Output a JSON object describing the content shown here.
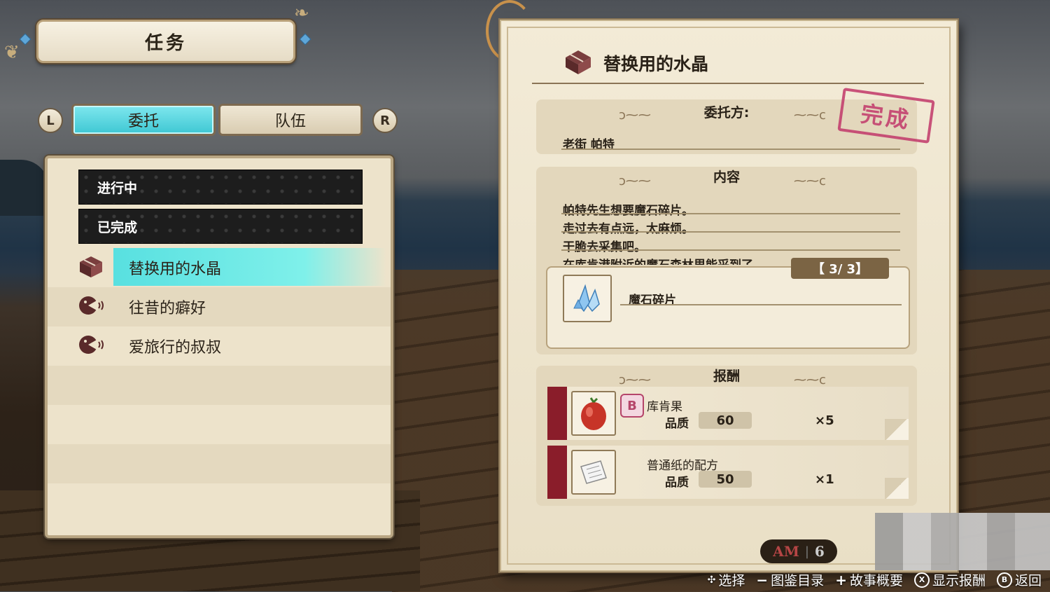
{
  "screen": {
    "title": "任务"
  },
  "tabs": {
    "left_shoulder": "L",
    "right_shoulder": "R",
    "items": [
      {
        "label": "委托",
        "active": true
      },
      {
        "label": "队伍",
        "active": false
      }
    ]
  },
  "quest_list": {
    "categories": [
      {
        "label": "进行中"
      },
      {
        "label": "已完成"
      }
    ],
    "quests": [
      {
        "label": "替换用的水晶",
        "icon": "box-icon",
        "selected": true
      },
      {
        "label": "往昔的癖好",
        "icon": "speech-icon",
        "selected": false
      },
      {
        "label": "爱旅行的叔叔",
        "icon": "speech-icon",
        "selected": false
      }
    ]
  },
  "detail": {
    "title": "替换用的水晶",
    "stamp": "完成",
    "client": {
      "heading": "委托方:",
      "name": "老街 帕特"
    },
    "content": {
      "heading": "内容",
      "lines": [
        "帕特先生想要魔石碎片。",
        "走过去有点远，太麻烦。",
        "干脆去采集吧。",
        "在库肯港附近的魔石森林里能采到了。"
      ]
    },
    "required_item": {
      "name": "魔石碎片",
      "progress": "【 3/ 3】",
      "icon": "crystal-icon"
    },
    "rewards": {
      "heading": "报酬",
      "items": [
        {
          "name": "库肯果",
          "badge": "B",
          "quality_label": "品质",
          "quality": "60",
          "qty": "×5",
          "icon": "red-fruit-icon"
        },
        {
          "name": "普通纸的配方",
          "badge": "",
          "quality_label": "品质",
          "quality": "50",
          "qty": "×1",
          "icon": "paper-icon"
        }
      ]
    }
  },
  "clock": {
    "period": "AM",
    "hour": "6"
  },
  "hints": [
    {
      "glyph": "dpad-icon",
      "label": "选择"
    },
    {
      "glyph": "minus-icon",
      "label": "图鉴目录"
    },
    {
      "glyph": "plus-icon",
      "label": "故事概要"
    },
    {
      "glyph": "x-button-icon",
      "key": "X",
      "label": "显示报酬"
    },
    {
      "glyph": "b-button-icon",
      "key": "B",
      "label": "返回"
    }
  ],
  "colors": {
    "accent_cyan": "#5fe0e4",
    "stamp_pink": "#c2386a",
    "ribbon_red": "#8a1d2a"
  }
}
